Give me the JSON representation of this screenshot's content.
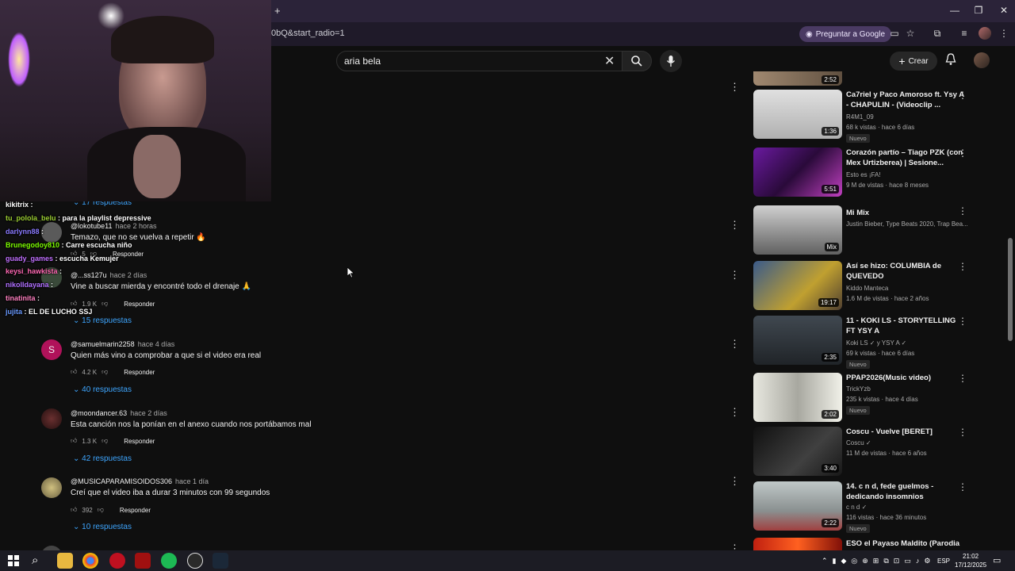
{
  "browser": {
    "url_fragment": "0bQ&start_radio=1",
    "new_tab": "+",
    "ask_google": "Preguntar a Google",
    "minimize": "—",
    "restore": "❐",
    "close": "✕"
  },
  "youtube_header": {
    "search_value": "aria bela",
    "create_label": "Crear"
  },
  "chat_overlay": [
    {
      "user": "kikitrix",
      "msg": ""
    },
    {
      "user": "tu_pololа_belu",
      "msg": "para la playlist depressive"
    },
    {
      "user": "darlynn88",
      "msg": ""
    },
    {
      "user": "Brunegodoy810",
      "msg": "Carre escucha niño"
    },
    {
      "user": "guady_games",
      "msg": "escucha Kemujer"
    },
    {
      "user": "keysi_hawkista",
      "msg": ""
    },
    {
      "user": "nikolldayana",
      "msg": ""
    },
    {
      "user": "tinatinita",
      "msg": ""
    },
    {
      "user": "jujita",
      "msg": "EL DE LUCHO SSJ"
    }
  ],
  "comments": {
    "partial_replies_top": "17 respuestas",
    "items": [
      {
        "author": "@lokotube11",
        "time": "hace 2 horas",
        "text": "Temazo, que no se vuelva a repetir 🔥",
        "likes": "5",
        "reply": "Responder",
        "replies": ""
      },
      {
        "author": "@...ss127u",
        "time": "hace 2 días",
        "text": "Vine a buscar mierda y encontré todo el drenaje 🙏",
        "likes": "1.9 K",
        "reply": "Responder",
        "replies": "15 respuestas"
      },
      {
        "author": "@samuelmarin2258",
        "time": "hace 4 días",
        "text": "Quien más vino a comprobar a que si el video era real",
        "likes": "4.2 K",
        "reply": "Responder",
        "replies": "40 respuestas"
      },
      {
        "author": "@moondancer.63",
        "time": "hace 2 días",
        "text": "Esta canción nos la ponían en el anexo cuando nos portábamos mal",
        "likes": "1.3 K",
        "reply": "Responder",
        "replies": "42 respuestas"
      },
      {
        "author": "@MUSICAPARAMISOIDOS306",
        "time": "hace 1 día",
        "text": "Creí que el video iba a durar 3 minutos con 99 segundos",
        "likes": "392",
        "reply": "Responder",
        "replies": "10 respuestas"
      }
    ],
    "avatar_letter": "S"
  },
  "recommendations": [
    {
      "title": "Ca7riel y Paco Amoroso ft. Ysy A - CHAPULIN - (Videoclip ...",
      "channel": "R4M1_09",
      "meta": "68 k vistas · hace 6 días",
      "badge": "Nuevo",
      "duration": "1:36"
    },
    {
      "title": "Corazón partío – Tiago PZK (con Mex Urtizberea) | Sesione...",
      "channel": "Esto es ¡FA!",
      "meta": "9 M de vistas · hace 8 meses",
      "badge": "",
      "duration": "5:51"
    },
    {
      "title": "Mi Mix",
      "channel": "Justin Bieber, Type Beats 2020, Trap Bea...",
      "meta": "",
      "badge": "",
      "duration": "Mix"
    },
    {
      "title": "Así se hizo: COLUMBIA de QUEVEDO",
      "channel": "Kiddo Manteca",
      "meta": "1.6 M de vistas · hace 2 años",
      "badge": "",
      "duration": "19:17"
    },
    {
      "title": "11 - KOKI LS - STORYTELLING FT YSY A",
      "channel": "Koki LS ✓ y YSY A ✓",
      "meta": "69 k vistas · hace 6 días",
      "badge": "Nuevo",
      "duration": "2:35"
    },
    {
      "title": "PPAP2026(Music video)",
      "channel": "TrickYzb",
      "meta": "235 k vistas · hace 4 días",
      "badge": "Nuevo",
      "duration": "2:02"
    },
    {
      "title": "Coscu - Vuelve [BERET]",
      "channel": "Coscu ✓",
      "meta": "11 M de vistas · hace 6 años",
      "badge": "",
      "duration": "3:40"
    },
    {
      "title": "14. c n d, fede guelmos - dedicando insomnios",
      "channel": "c n d ✓",
      "meta": "116 vistas · hace 36 minutos",
      "badge": "Nuevo",
      "duration": "2:22"
    },
    {
      "title": "ESO el Payaso Maldito (Parodia",
      "channel": "",
      "meta": "",
      "badge": "",
      "duration": ""
    }
  ],
  "top_partial_duration": "2:52",
  "taskbar": {
    "lang": "ESP",
    "time": "21:02",
    "date": "17/12/2025"
  }
}
